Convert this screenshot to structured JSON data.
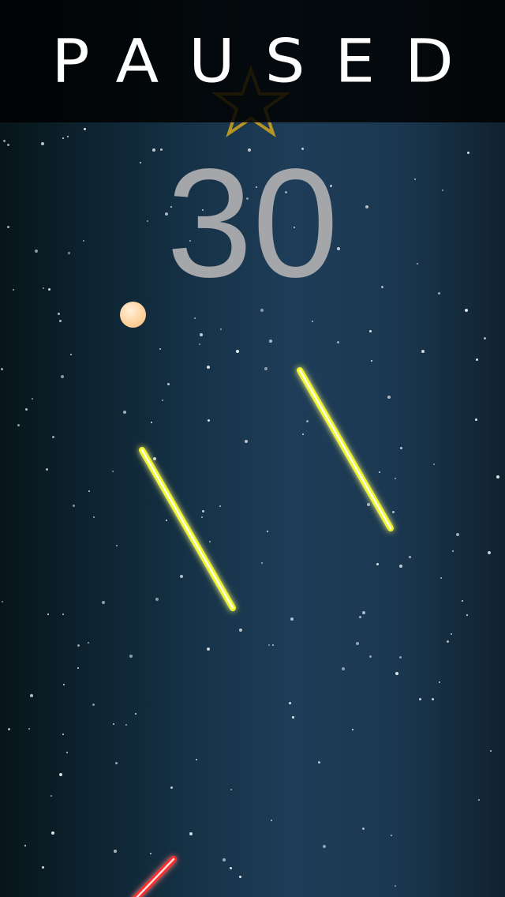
{
  "game": {
    "status_label": "PAUSED",
    "score": "30"
  },
  "colors": {
    "background_center": "#1e3d58",
    "background_edge": "#071519",
    "star": "#e8eef4",
    "paddle_blue": "#2f56ff",
    "bar_yellow": "#f2f52a",
    "bar_red": "#ff2a2a",
    "ball": "#ffd8a8",
    "star_icon": "#c8a020",
    "score": "#a4a6a9"
  },
  "icons": {
    "bonus": "star-icon"
  }
}
